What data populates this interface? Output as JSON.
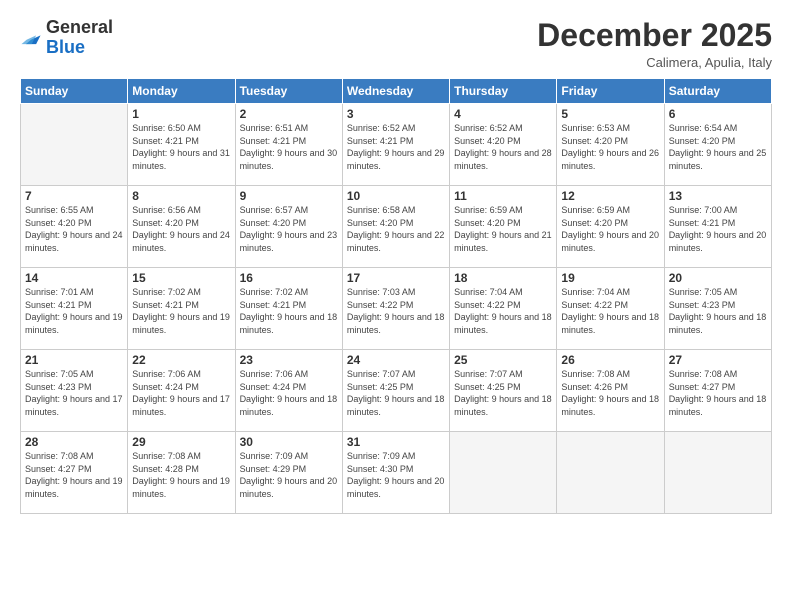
{
  "header": {
    "logo_line1": "General",
    "logo_line2": "Blue",
    "month": "December 2025",
    "location": "Calimera, Apulia, Italy"
  },
  "weekdays": [
    "Sunday",
    "Monday",
    "Tuesday",
    "Wednesday",
    "Thursday",
    "Friday",
    "Saturday"
  ],
  "weeks": [
    [
      {
        "day": "",
        "sunrise": "",
        "sunset": "",
        "daylight": ""
      },
      {
        "day": "1",
        "sunrise": "Sunrise: 6:50 AM",
        "sunset": "Sunset: 4:21 PM",
        "daylight": "Daylight: 9 hours and 31 minutes."
      },
      {
        "day": "2",
        "sunrise": "Sunrise: 6:51 AM",
        "sunset": "Sunset: 4:21 PM",
        "daylight": "Daylight: 9 hours and 30 minutes."
      },
      {
        "day": "3",
        "sunrise": "Sunrise: 6:52 AM",
        "sunset": "Sunset: 4:21 PM",
        "daylight": "Daylight: 9 hours and 29 minutes."
      },
      {
        "day": "4",
        "sunrise": "Sunrise: 6:52 AM",
        "sunset": "Sunset: 4:20 PM",
        "daylight": "Daylight: 9 hours and 28 minutes."
      },
      {
        "day": "5",
        "sunrise": "Sunrise: 6:53 AM",
        "sunset": "Sunset: 4:20 PM",
        "daylight": "Daylight: 9 hours and 26 minutes."
      },
      {
        "day": "6",
        "sunrise": "Sunrise: 6:54 AM",
        "sunset": "Sunset: 4:20 PM",
        "daylight": "Daylight: 9 hours and 25 minutes."
      }
    ],
    [
      {
        "day": "7",
        "sunrise": "Sunrise: 6:55 AM",
        "sunset": "Sunset: 4:20 PM",
        "daylight": "Daylight: 9 hours and 24 minutes."
      },
      {
        "day": "8",
        "sunrise": "Sunrise: 6:56 AM",
        "sunset": "Sunset: 4:20 PM",
        "daylight": "Daylight: 9 hours and 24 minutes."
      },
      {
        "day": "9",
        "sunrise": "Sunrise: 6:57 AM",
        "sunset": "Sunset: 4:20 PM",
        "daylight": "Daylight: 9 hours and 23 minutes."
      },
      {
        "day": "10",
        "sunrise": "Sunrise: 6:58 AM",
        "sunset": "Sunset: 4:20 PM",
        "daylight": "Daylight: 9 hours and 22 minutes."
      },
      {
        "day": "11",
        "sunrise": "Sunrise: 6:59 AM",
        "sunset": "Sunset: 4:20 PM",
        "daylight": "Daylight: 9 hours and 21 minutes."
      },
      {
        "day": "12",
        "sunrise": "Sunrise: 6:59 AM",
        "sunset": "Sunset: 4:20 PM",
        "daylight": "Daylight: 9 hours and 20 minutes."
      },
      {
        "day": "13",
        "sunrise": "Sunrise: 7:00 AM",
        "sunset": "Sunset: 4:21 PM",
        "daylight": "Daylight: 9 hours and 20 minutes."
      }
    ],
    [
      {
        "day": "14",
        "sunrise": "Sunrise: 7:01 AM",
        "sunset": "Sunset: 4:21 PM",
        "daylight": "Daylight: 9 hours and 19 minutes."
      },
      {
        "day": "15",
        "sunrise": "Sunrise: 7:02 AM",
        "sunset": "Sunset: 4:21 PM",
        "daylight": "Daylight: 9 hours and 19 minutes."
      },
      {
        "day": "16",
        "sunrise": "Sunrise: 7:02 AM",
        "sunset": "Sunset: 4:21 PM",
        "daylight": "Daylight: 9 hours and 18 minutes."
      },
      {
        "day": "17",
        "sunrise": "Sunrise: 7:03 AM",
        "sunset": "Sunset: 4:22 PM",
        "daylight": "Daylight: 9 hours and 18 minutes."
      },
      {
        "day": "18",
        "sunrise": "Sunrise: 7:04 AM",
        "sunset": "Sunset: 4:22 PM",
        "daylight": "Daylight: 9 hours and 18 minutes."
      },
      {
        "day": "19",
        "sunrise": "Sunrise: 7:04 AM",
        "sunset": "Sunset: 4:22 PM",
        "daylight": "Daylight: 9 hours and 18 minutes."
      },
      {
        "day": "20",
        "sunrise": "Sunrise: 7:05 AM",
        "sunset": "Sunset: 4:23 PM",
        "daylight": "Daylight: 9 hours and 18 minutes."
      }
    ],
    [
      {
        "day": "21",
        "sunrise": "Sunrise: 7:05 AM",
        "sunset": "Sunset: 4:23 PM",
        "daylight": "Daylight: 9 hours and 17 minutes."
      },
      {
        "day": "22",
        "sunrise": "Sunrise: 7:06 AM",
        "sunset": "Sunset: 4:24 PM",
        "daylight": "Daylight: 9 hours and 17 minutes."
      },
      {
        "day": "23",
        "sunrise": "Sunrise: 7:06 AM",
        "sunset": "Sunset: 4:24 PM",
        "daylight": "Daylight: 9 hours and 18 minutes."
      },
      {
        "day": "24",
        "sunrise": "Sunrise: 7:07 AM",
        "sunset": "Sunset: 4:25 PM",
        "daylight": "Daylight: 9 hours and 18 minutes."
      },
      {
        "day": "25",
        "sunrise": "Sunrise: 7:07 AM",
        "sunset": "Sunset: 4:25 PM",
        "daylight": "Daylight: 9 hours and 18 minutes."
      },
      {
        "day": "26",
        "sunrise": "Sunrise: 7:08 AM",
        "sunset": "Sunset: 4:26 PM",
        "daylight": "Daylight: 9 hours and 18 minutes."
      },
      {
        "day": "27",
        "sunrise": "Sunrise: 7:08 AM",
        "sunset": "Sunset: 4:27 PM",
        "daylight": "Daylight: 9 hours and 18 minutes."
      }
    ],
    [
      {
        "day": "28",
        "sunrise": "Sunrise: 7:08 AM",
        "sunset": "Sunset: 4:27 PM",
        "daylight": "Daylight: 9 hours and 19 minutes."
      },
      {
        "day": "29",
        "sunrise": "Sunrise: 7:08 AM",
        "sunset": "Sunset: 4:28 PM",
        "daylight": "Daylight: 9 hours and 19 minutes."
      },
      {
        "day": "30",
        "sunrise": "Sunrise: 7:09 AM",
        "sunset": "Sunset: 4:29 PM",
        "daylight": "Daylight: 9 hours and 20 minutes."
      },
      {
        "day": "31",
        "sunrise": "Sunrise: 7:09 AM",
        "sunset": "Sunset: 4:30 PM",
        "daylight": "Daylight: 9 hours and 20 minutes."
      },
      {
        "day": "",
        "sunrise": "",
        "sunset": "",
        "daylight": ""
      },
      {
        "day": "",
        "sunrise": "",
        "sunset": "",
        "daylight": ""
      },
      {
        "day": "",
        "sunrise": "",
        "sunset": "",
        "daylight": ""
      }
    ]
  ]
}
